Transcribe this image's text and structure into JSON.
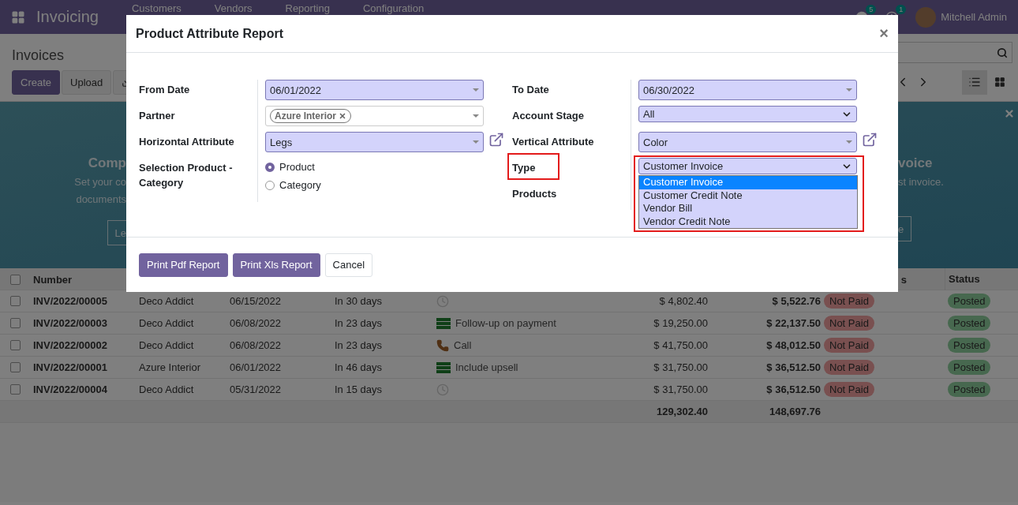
{
  "topbar": {
    "app_title": "Invoicing",
    "menu": [
      "Customers",
      "Vendors",
      "Reporting",
      "Configuration"
    ],
    "messages_badge": "5",
    "activities_badge": "1",
    "user": "Mitchell Admin"
  },
  "control_panel": {
    "breadcrumb": "Invoices",
    "buttons": [
      "Create",
      "Upload"
    ],
    "views": [
      {
        "kind": "list",
        "selected": true
      },
      {
        "kind": "kanban",
        "selected": false
      }
    ]
  },
  "banner": {
    "left_title": "Comp",
    "left_lines": [
      "Set your co",
      "documents"
    ],
    "left_button": "Le",
    "right_title": "voice",
    "right_line": "st invoice.",
    "right_button": "e"
  },
  "table": {
    "columns": [
      "Number",
      "s",
      "Status"
    ],
    "all_checked": false,
    "rows": [
      {
        "checked": false,
        "number": "INV/2022/00005",
        "customer": "Deco Addict",
        "date": "06/15/2022",
        "due": "In 30 days",
        "activity": {
          "kind": "none"
        },
        "untaxed": "$ 4,802.40",
        "total": "$ 5,522.76",
        "payment": "Not Paid",
        "status": "Posted"
      },
      {
        "checked": false,
        "number": "INV/2022/00003",
        "customer": "Deco Addict",
        "date": "06/08/2022",
        "due": "In 23 days",
        "activity": {
          "kind": "todo",
          "text": "Follow-up on payment"
        },
        "untaxed": "$ 19,250.00",
        "total": "$ 22,137.50",
        "payment": "Not Paid",
        "status": "Posted"
      },
      {
        "checked": false,
        "number": "INV/2022/00002",
        "customer": "Deco Addict",
        "date": "06/08/2022",
        "due": "In 23 days",
        "activity": {
          "kind": "call",
          "text": "Call"
        },
        "untaxed": "$ 41,750.00",
        "total": "$ 48,012.50",
        "payment": "Not Paid",
        "status": "Posted"
      },
      {
        "checked": false,
        "number": "INV/2022/00001",
        "customer": "Azure Interior",
        "date": "06/01/2022",
        "due": "In 46 days",
        "activity": {
          "kind": "todo",
          "text": "Include upsell"
        },
        "untaxed": "$ 31,750.00",
        "total": "$ 36,512.50",
        "payment": "Not Paid",
        "status": "Posted"
      },
      {
        "checked": false,
        "number": "INV/2022/00004",
        "customer": "Deco Addict",
        "date": "05/31/2022",
        "due": "In 15 days",
        "activity": {
          "kind": "none"
        },
        "untaxed": "$ 31,750.00",
        "total": "$ 36,512.50",
        "payment": "Not Paid",
        "status": "Posted"
      }
    ],
    "totals": {
      "untaxed": "129,302.40",
      "total": "148,697.76"
    }
  },
  "dialog": {
    "title": "Product Attribute Report",
    "close": "×",
    "left": [
      {
        "kind": "date",
        "label": "From Date",
        "value": "06/01/2022"
      },
      {
        "kind": "tags",
        "label": "Partner",
        "tags": [
          "Azure Interior"
        ]
      },
      {
        "kind": "many2one",
        "label": "Horizontal Attribute",
        "value": "Legs"
      },
      {
        "kind": "radio",
        "label": "Selection Product - Category",
        "options": [
          {
            "label": "Product",
            "selected": true
          },
          {
            "label": "Category",
            "selected": false
          }
        ]
      }
    ],
    "right": [
      {
        "kind": "date",
        "label": "To Date",
        "value": "06/30/2022"
      },
      {
        "kind": "select",
        "label": "Account Stage",
        "value": "All"
      },
      {
        "kind": "many2one",
        "label": "Vertical Attribute",
        "value": "Color"
      },
      {
        "kind": "dropdown",
        "label": "Type",
        "highlighted": true,
        "value": "Customer Invoice",
        "expanded": true,
        "options": [
          {
            "label": "Customer Invoice",
            "selected": true
          },
          {
            "label": "Customer Credit Note",
            "selected": false
          },
          {
            "label": "Vendor Bill",
            "selected": false
          },
          {
            "label": "Vendor Credit Note",
            "selected": false
          }
        ]
      },
      {
        "kind": "hidden",
        "label": "Products"
      }
    ],
    "buttons": [
      {
        "label": "Print Pdf Report",
        "primary": true
      },
      {
        "label": "Print Xls Report",
        "primary": true
      },
      {
        "label": "Cancel",
        "primary": false
      }
    ]
  }
}
